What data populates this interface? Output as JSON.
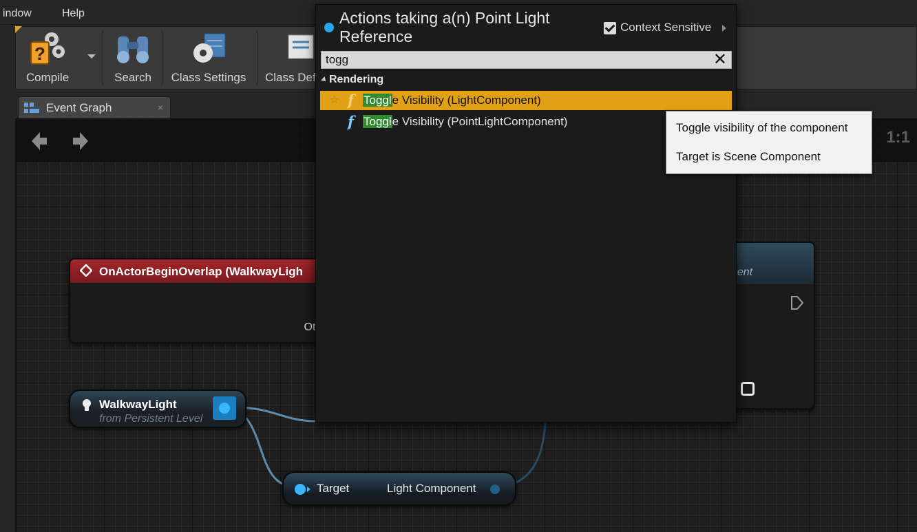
{
  "menu": {
    "items": [
      "indow",
      "Help"
    ]
  },
  "toolbar": {
    "compile": "Compile",
    "search": "Search",
    "class_settings": "Class Settings",
    "class_defaults": "Class Def"
  },
  "tab": {
    "label": "Event Graph",
    "close": "×"
  },
  "graph": {
    "zoom": "1:1"
  },
  "nodes": {
    "event": {
      "title": "OnActorBeginOverlap (WalkwayLigh",
      "pin": "Otl"
    },
    "right": {
      "label": "nent"
    },
    "variable": {
      "title": "WalkwayLight",
      "subtitle": "from Persistent Level"
    },
    "component": {
      "input": "Target",
      "output": "Light Component"
    }
  },
  "popup": {
    "title": "Actions taking a(n) Point Light Reference",
    "context_label": "Context Sensitive",
    "context_checked": true,
    "search_value": "togg",
    "clear": "✕",
    "category": "Rendering",
    "fn_glyph": "f",
    "star": "☆",
    "actions": [
      {
        "match": "Toggl",
        "rest": "e Visibility (LightComponent)",
        "selected": true
      },
      {
        "match": "Toggl",
        "rest": "e Visibility (PointLightComponent)",
        "selected": false
      }
    ]
  },
  "tooltip": {
    "line1": "Toggle visibility of the component",
    "line2": "Target is Scene Component"
  },
  "colors": {
    "selection": "#e2a114",
    "match_highlight": "#2e8b2e",
    "pin_blue": "#38b6ff",
    "event_header": "#a3262a"
  }
}
